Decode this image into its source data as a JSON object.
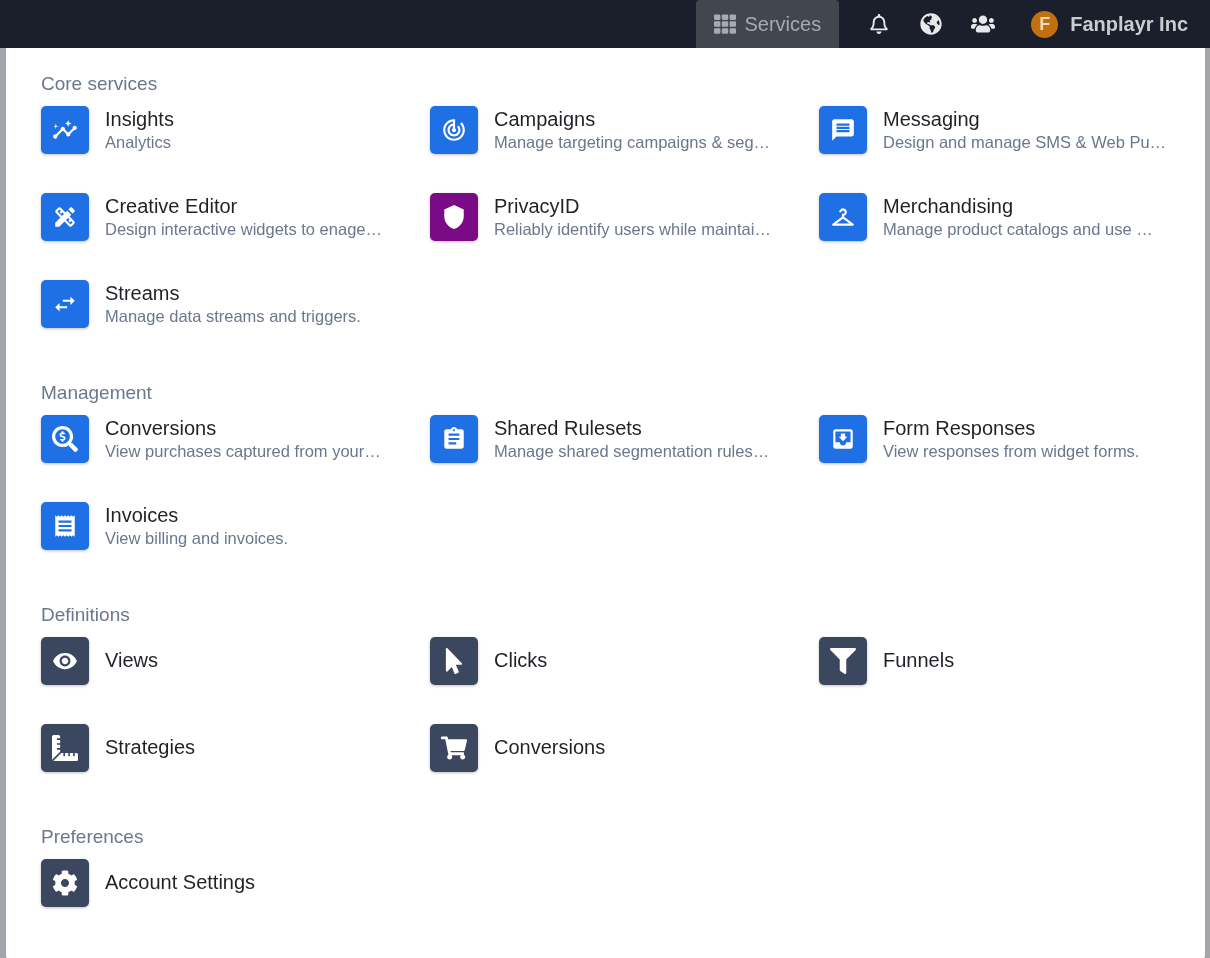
{
  "topbar": {
    "services": {
      "label": "Services",
      "selected": true
    },
    "account": {
      "initial": "F",
      "name": "Fanplayr Inc"
    }
  },
  "sections": [
    {
      "title": "Core services",
      "items": [
        {
          "title": "Insights",
          "subtitle": "Analytics",
          "color": "#1f6fe5"
        },
        {
          "title": "Campaigns",
          "subtitle": "Manage targeting campaigns & seg…",
          "color": "#1f6fe5"
        },
        {
          "title": "Messaging",
          "subtitle": "Design and manage SMS & Web Pu…",
          "color": "#1f6fe5"
        },
        {
          "title": "Creative Editor",
          "subtitle": "Design interactive widgets to enage…",
          "color": "#1f6fe5"
        },
        {
          "title": "PrivacyID",
          "subtitle": "Reliably identify users while maintai…",
          "color": "#7b0a86"
        },
        {
          "title": "Merchandising",
          "subtitle": "Manage product catalogs and use …",
          "color": "#1f6fe5"
        },
        {
          "title": "Streams",
          "subtitle": "Manage data streams and triggers.",
          "color": "#1f6fe5"
        }
      ]
    },
    {
      "title": "Management",
      "items": [
        {
          "title": "Conversions",
          "subtitle": "View purchases captured from your…",
          "color": "#1f6fe5"
        },
        {
          "title": "Shared Rulesets",
          "subtitle": "Manage shared segmentation rules…",
          "color": "#1f6fe5"
        },
        {
          "title": "Form Responses",
          "subtitle": "View responses from widget forms.",
          "color": "#1f6fe5"
        },
        {
          "title": "Invoices",
          "subtitle": "View billing and invoices.",
          "color": "#1f6fe5"
        }
      ]
    },
    {
      "title": "Definitions",
      "items": [
        {
          "title": "Views",
          "color": "#3b475e"
        },
        {
          "title": "Clicks",
          "color": "#3b475e"
        },
        {
          "title": "Funnels",
          "color": "#3b475e"
        },
        {
          "title": "Strategies",
          "color": "#3b475e"
        },
        {
          "title": "Conversions",
          "color": "#3b475e"
        }
      ]
    },
    {
      "title": "Preferences",
      "items": [
        {
          "title": "Account Settings",
          "color": "#3b475e"
        }
      ]
    }
  ]
}
